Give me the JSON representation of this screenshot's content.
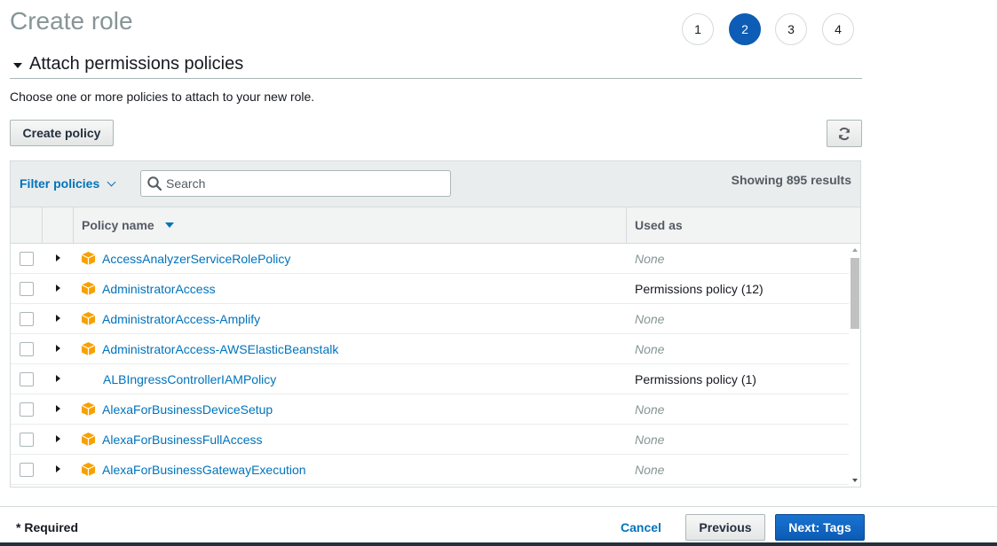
{
  "page": {
    "title": "Create role"
  },
  "steps": [
    "1",
    "2",
    "3",
    "4"
  ],
  "active_step": "2",
  "section": {
    "title": "Attach permissions policies",
    "description": "Choose one or more policies to attach to your new role."
  },
  "actions": {
    "create_policy": "Create policy",
    "refresh_icon": "refresh-icon"
  },
  "toolbar": {
    "filter_label": "Filter policies",
    "search_placeholder": "Search",
    "results_text": "Showing 895 results"
  },
  "table": {
    "columns": {
      "policy_name": "Policy name",
      "used_as": "Used as"
    },
    "rows": [
      {
        "name": "AccessAnalyzerServiceRolePolicy",
        "used_as": "None",
        "aws_managed": true
      },
      {
        "name": "AdministratorAccess",
        "used_as": "Permissions policy (12)",
        "aws_managed": true
      },
      {
        "name": "AdministratorAccess-Amplify",
        "used_as": "None",
        "aws_managed": true
      },
      {
        "name": "AdministratorAccess-AWSElasticBeanstalk",
        "used_as": "None",
        "aws_managed": true
      },
      {
        "name": "ALBIngressControllerIAMPolicy",
        "used_as": "Permissions policy (1)",
        "aws_managed": false
      },
      {
        "name": "AlexaForBusinessDeviceSetup",
        "used_as": "None",
        "aws_managed": true
      },
      {
        "name": "AlexaForBusinessFullAccess",
        "used_as": "None",
        "aws_managed": true
      },
      {
        "name": "AlexaForBusinessGatewayExecution",
        "used_as": "None",
        "aws_managed": true
      }
    ]
  },
  "footer": {
    "required_label": "* Required",
    "cancel_label": "Cancel",
    "previous_label": "Previous",
    "next_label": "Next: Tags"
  },
  "colors": {
    "accent": "#0073bb",
    "primary_button": "#0d5cb6",
    "policy_icon": "#f7a100"
  }
}
